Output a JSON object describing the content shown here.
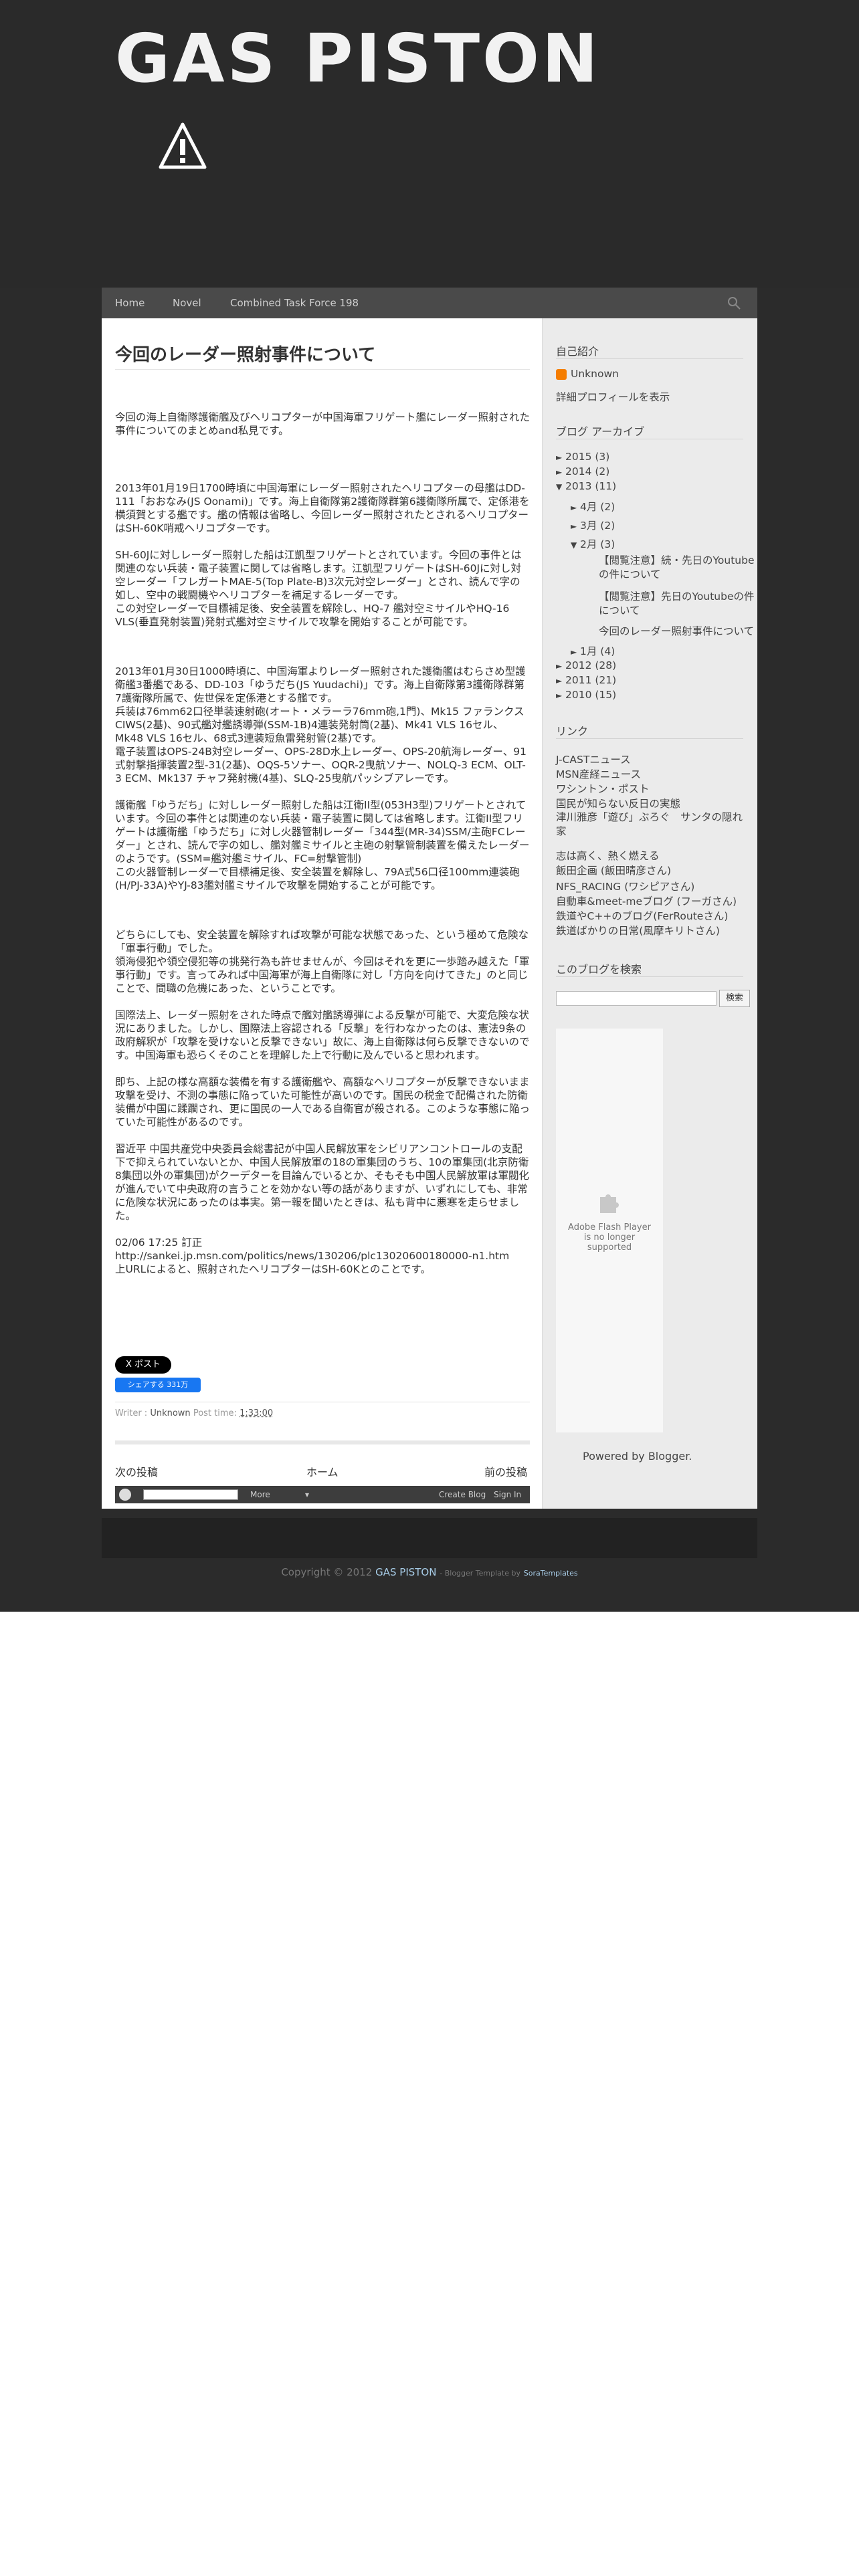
{
  "header": {
    "site_title": "GAS PISTON"
  },
  "nav": {
    "items": [
      "Home",
      "Novel",
      "Combined Task Force 198"
    ]
  },
  "post": {
    "title": "今回のレーダー照射事件について",
    "paragraphs": [
      "今回の海上自衛隊護衛艦及びヘリコプターが中国海軍フリゲート艦にレーダー照射された事件についてのまとめand私見です。",
      "",
      "2013年01月19日1700時頃に中国海軍にレーダー照射されたヘリコプターの母艦はDD-111「おおなみ(JS Oonami)」です。海上自衛隊第2護衛隊群第6護衛隊所属で、定係港を横須賀とする艦です。艦の情報は省略し、今回レーダー照射されたとされるヘリコプターはSH-60K哨戒ヘリコプターです。",
      "SH-60Jに対しレーダー照射した船は江凱型フリゲートとされています。今回の事件とは関連のない兵装・電子装置に関しては省略します。江凱型フリゲートはSH-60Jに対し対空レーダー「フレガートMAE-5(Top Plate-B)3次元対空レーダー」とされ、読んで字の如し、空中の戦闘機やヘリコプターを補足するレーダーです。\nこの対空レーダーで目標補足後、安全装置を解除し、HQ-7 艦対空ミサイルやHQ-16 VLS(垂直発射装置)発射式艦対空ミサイルで攻撃を開始することが可能です。",
      "",
      "2013年01月30日1000時頃に、中国海軍よりレーダー照射された護衛艦はむらさめ型護衛艦3番艦である、DD-103「ゆうだち(JS Yuudachi)」です。海上自衛隊第3護衛隊群第7護衛隊所属で、佐世保を定係港とする艦です。\n兵装は76mm62口径単装速射砲(オート・メラーラ76mm砲,1門)、Mk15 ファランクスCIWS(2基)、90式艦対艦誘導弾(SSM-1B)4連装発射筒(2基)、Mk41 VLS 16セル、Mk48 VLS 16セル、68式3連装短魚雷発射管(2基)です。\n電子装置はOPS-24B対空レーダー、OPS-28D水上レーダー、OPS-20航海レーダー、91式射撃指揮装置2型-31(2基)、OQS-5ソナー、OQR-2曳航ソナー、NOLQ-3 ECM、OLT-3 ECM、Mk137 チャフ発射機(4基)、SLQ-25曳航パッシブアレーです。",
      "護衛艦「ゆうだち」に対しレーダー照射した船は江衛II型(053H3型)フリゲートとされています。今回の事件とは関連のない兵装・電子装置に関しては省略します。江衛II型フリゲートは護衛艦「ゆうだち」に対し火器管制レーダー「344型(MR-34)SSM/主砲FCレーダー」とされ、読んで字の如し、艦対艦ミサイルと主砲の射撃管制装置を備えたレーダーのようです。(SSM=艦対艦ミサイル、FC=射撃管制)\nこの火器管制レーダーで目標補足後、安全装置を解除し、79A式56口径100mm連装砲(H/PJ-33A)やYJ-83艦対艦ミサイルで攻撃を開始することが可能です。",
      "",
      "どちらにしても、安全装置を解除すれば攻撃が可能な状態であった、という極めて危険な「軍事行動」でした。\n領海侵犯や領空侵犯等の挑発行為も許せませんが、今回はそれを更に一歩踏み越えた「軍事行動」です。言ってみれば中国海軍が海上自衛隊に対し「方向を向けてきた」のと同じことで、間職の危機にあった、ということです。",
      "国際法上、レーダー照射をされた時点で艦対艦誘導弾による反撃が可能で、大変危険な状況にありました。しかし、国際法上容認される「反撃」を行わなかったのは、憲法9条の政府解釈が「攻撃を受けないと反撃できない」故に、海上自衛隊は何ら反撃できないのです。中国海軍も恐らくそのことを理解した上で行動に及んでいると思われます。",
      "即ち、上記の様な高額な装備を有する護衛艦や、高額なヘリコプターが反撃できないまま攻撃を受け、不測の事態に陥っていた可能性が高いのです。国民の税金で配備された防衛装備が中国に蹂躙され、更に国民の一人である自衛官が殺される。このような事態に陥っていた可能性があるのです。",
      "習近平 中国共産党中央委員会総書記が中国人民解放軍をシビリアンコントロールの支配下で抑えられていないとか、中国人民解放軍の18の軍集団のうち、10の軍集団(北京防衛8集団以外の軍集団)がクーデターを目論んでいるとか、そもそも中国人民解放軍は軍閥化が進んでいて中央政府の言うことを効かない等の話がありますが、いずれにしても、非常に危険な状況にあったのは事実。第一報を聞いたときは、私も背中に悪寒を走らせました。"
    ],
    "correction_label": "02/06 17:25 訂正",
    "correction_url": "http://sankei.jp.msn.com/politics/news/130206/plc13020600180000-n1.htm",
    "correction_text": "上URLによると、照射されたヘリコプターはSH-60Kとのことです。",
    "x_button_label": "X ポスト",
    "fb_button_label": "シェアする 331万",
    "meta_writer_label": "Writer :",
    "meta_writer": "Unknown",
    "meta_time_label": "Post time:",
    "meta_time": "1:33:00"
  },
  "pager": {
    "newer": "次の投稿",
    "home": "ホーム",
    "older": "前の投稿"
  },
  "navbar": {
    "more_label": "More",
    "create_blog": "Create Blog",
    "sign_in": "Sign In"
  },
  "sidebar": {
    "profile_title": "自己紹介",
    "profile_name": "Unknown",
    "profile_link": "詳細プロフィールを表示",
    "archive_title": "ブログ アーカイブ",
    "archive": [
      {
        "label": "2015 (3)",
        "state": "collapsed",
        "level": 0
      },
      {
        "label": "2014 (2)",
        "state": "collapsed",
        "level": 0
      },
      {
        "label": "2013 (11)",
        "state": "expanded",
        "level": 0
      },
      {
        "label": "4月 (2)",
        "state": "collapsed",
        "level": 1
      },
      {
        "label": "3月 (2)",
        "state": "collapsed",
        "level": 1
      },
      {
        "label": "2月 (3)",
        "state": "expanded",
        "level": 1
      },
      {
        "label": "1月 (4)",
        "state": "collapsed",
        "level": 1
      },
      {
        "label": "2012 (28)",
        "state": "collapsed",
        "level": 0
      },
      {
        "label": "2011 (21)",
        "state": "collapsed",
        "level": 0
      },
      {
        "label": "2010 (15)",
        "state": "collapsed",
        "level": 0
      }
    ],
    "feb_posts": [
      "【閲覧注意】続・先日のYoutubeの件について",
      "【閲覧注意】先日のYoutubeの件について",
      "今回のレーダー照射事件について"
    ],
    "links_title": "リンク",
    "links": [
      "J-CASTニュース",
      "MSN産経ニュース",
      "ワシントン・ポスト",
      "国民が知らない反日の実態",
      "津川雅彦「遊び」ぶろぐ　サンタの隠れ家",
      "志は高く、熱く燃える",
      "飯田企画 (飯田晴彦さん)",
      "NFS_RACING (ワシピアさん)",
      "自動車&meet-meブログ (フーガさん)",
      "鉄道やC++のブログ(FerRouteさん)",
      "鉄道ばかりの日常(風摩キリトさん)"
    ],
    "search_title": "このブログを検索",
    "search_button": "検索",
    "flash_text": "Adobe Flash Player\nis no longer\nsupported",
    "powered": "Powered by Blogger."
  },
  "footer": {
    "copyright_prefix": "Copyright © 2012",
    "copyright_site": "GAS PISTON",
    "template_prefix": "- Blogger Template by",
    "template_author": "SoraTemplates"
  },
  "colors": {
    "background_dark": "#2b2b2b",
    "nav": "#4a4a4a",
    "sidebar": "#ebebeb",
    "link_accent": "#a8cde8",
    "fb_blue": "#1877f2",
    "blogger_orange": "#f57d00"
  }
}
